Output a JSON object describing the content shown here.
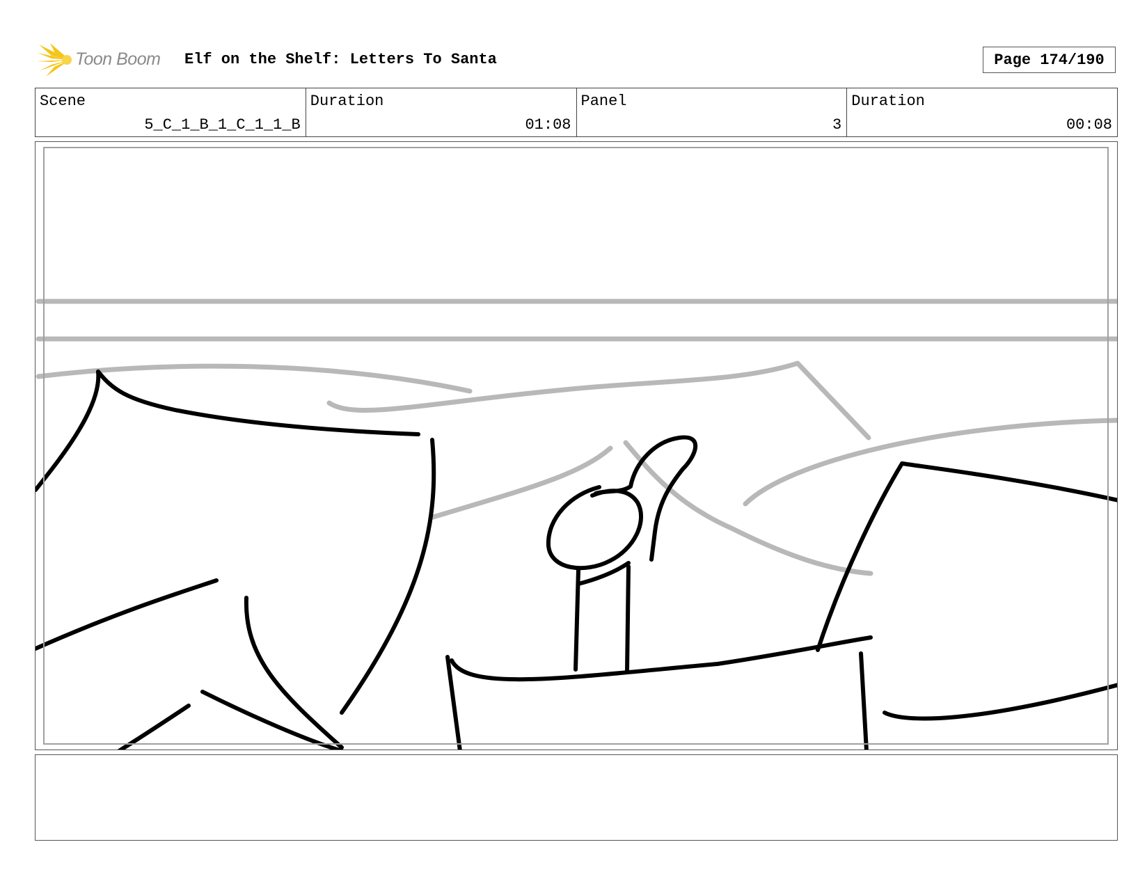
{
  "header": {
    "logo_text": "Toon Boom",
    "title": "Elf on the Shelf: Letters To Santa",
    "page_label": "Page 174/190"
  },
  "info": {
    "scene_label": "Scene",
    "scene_value": "5_C_1_B_1_C_1_1_B",
    "scene_duration_label": "Duration",
    "scene_duration_value": "01:08",
    "panel_label": "Panel",
    "panel_value": "3",
    "panel_duration_label": "Duration",
    "panel_duration_value": "00:08"
  },
  "colors": {
    "logo_star": "#f5c518",
    "sketch_ink": "#000000",
    "sketch_rough": "#b8b8b8",
    "frame_border": "#555555"
  },
  "notes": {
    "text": ""
  }
}
